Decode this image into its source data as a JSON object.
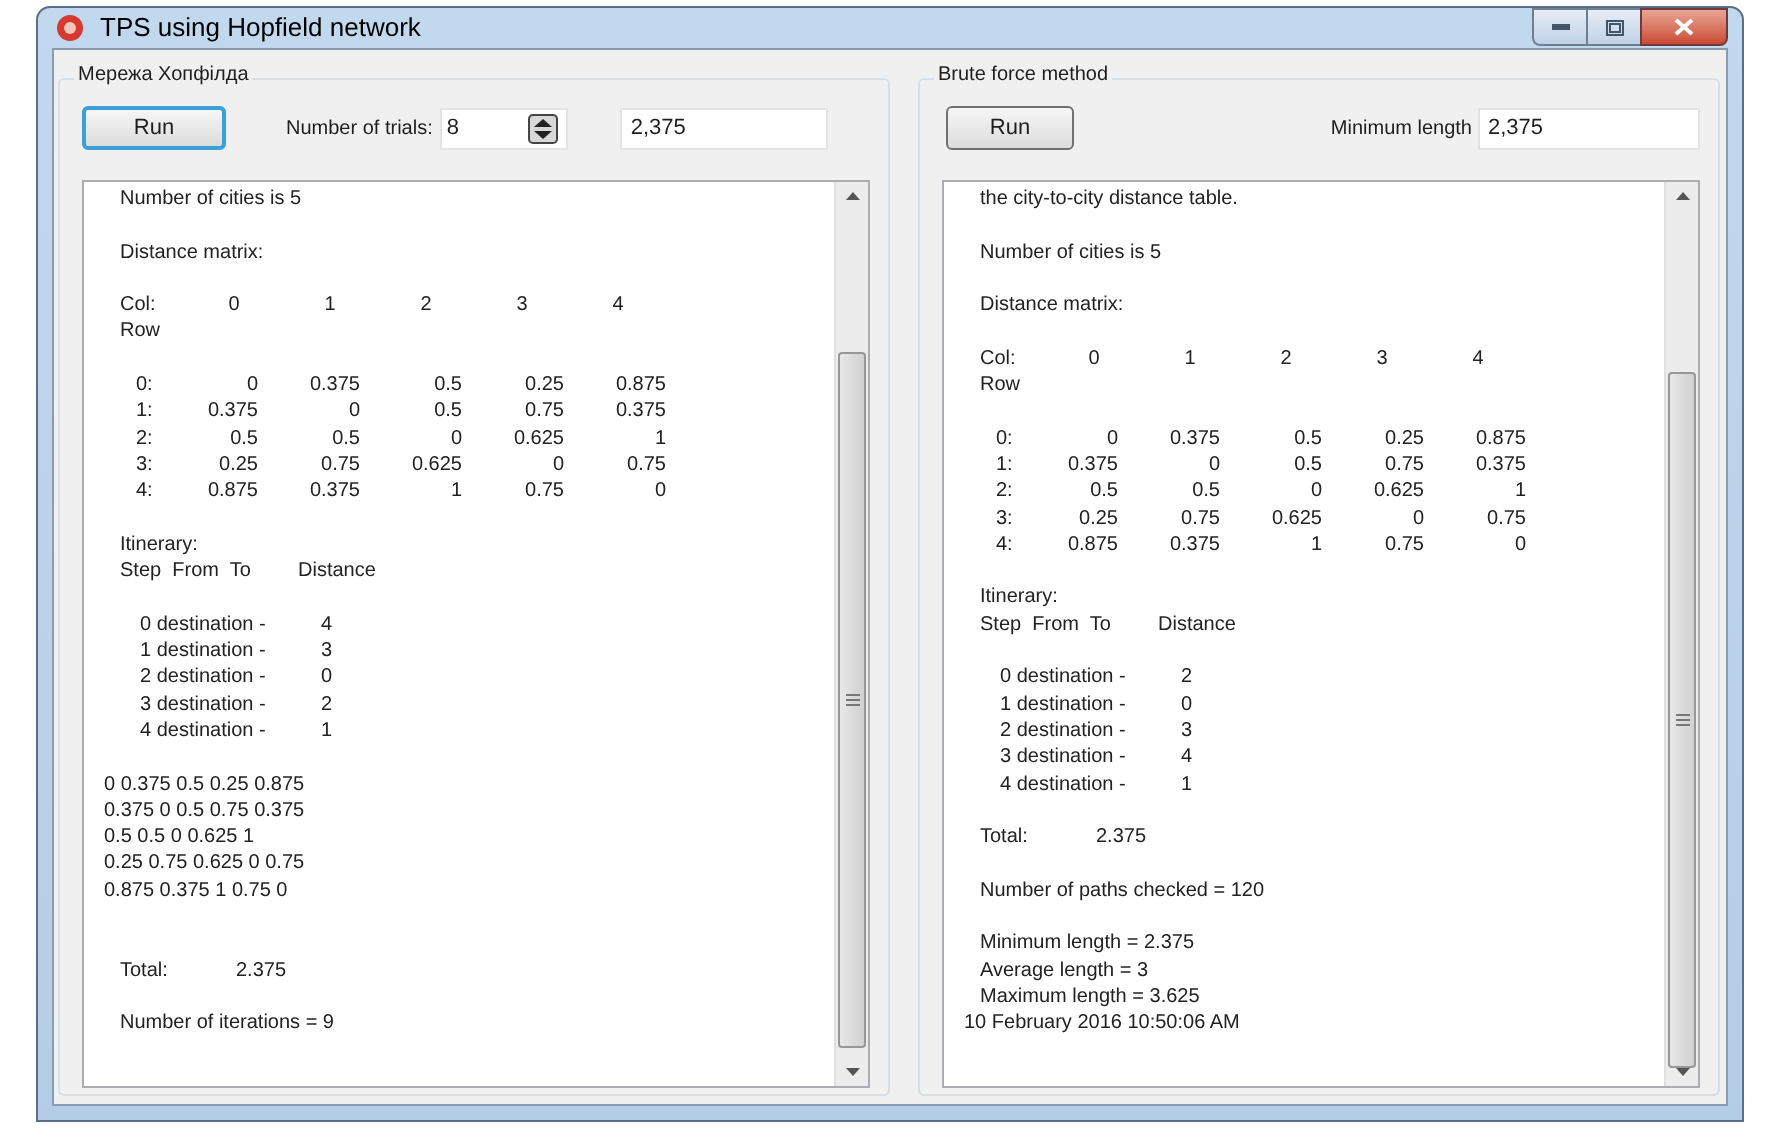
{
  "window": {
    "title": "TPS using Hopfield network"
  },
  "hopfield": {
    "title": "Мережа Хопфілда",
    "run_button": {
      "label": "Run",
      "focused": true
    },
    "trials_label": "Number of trials:",
    "trials_value": "8",
    "result_value": "2,375",
    "output": [
      {
        "kind": "text",
        "text": "Number of cities is 5"
      },
      {
        "kind": "space"
      },
      {
        "kind": "text",
        "text": "Distance matrix:"
      },
      {
        "kind": "space"
      },
      {
        "kind": "header",
        "cells": [
          "Col:",
          "0",
          "1",
          "2",
          "3",
          "4"
        ]
      },
      {
        "kind": "text",
        "text": "Row"
      },
      {
        "kind": "space"
      },
      {
        "kind": "matrix",
        "cells": [
          "0:",
          "0",
          "0.375",
          "0.5",
          "0.25",
          "0.875"
        ]
      },
      {
        "kind": "matrix",
        "cells": [
          "1:",
          "0.375",
          "0",
          "0.5",
          "0.75",
          "0.375"
        ]
      },
      {
        "kind": "matrix",
        "cells": [
          "2:",
          "0.5",
          "0.5",
          "0",
          "0.625",
          "1"
        ]
      },
      {
        "kind": "matrix",
        "cells": [
          "3:",
          "0.25",
          "0.75",
          "0.625",
          "0",
          "0.75"
        ]
      },
      {
        "kind": "matrix",
        "cells": [
          "4:",
          "0.875",
          "0.375",
          "1",
          "0.75",
          "0"
        ]
      },
      {
        "kind": "space"
      },
      {
        "kind": "text",
        "text": "Itinerary:"
      },
      {
        "kind": "itinerary_head",
        "cells": [
          "Step  From  To",
          "Distance"
        ]
      },
      {
        "kind": "space"
      },
      {
        "kind": "itinerary",
        "cells": [
          "0 destination -",
          "4"
        ]
      },
      {
        "kind": "itinerary",
        "cells": [
          "1 destination -",
          "3"
        ]
      },
      {
        "kind": "itinerary",
        "cells": [
          "2 destination -",
          "0"
        ]
      },
      {
        "kind": "itinerary",
        "cells": [
          "3 destination -",
          "2"
        ]
      },
      {
        "kind": "itinerary",
        "cells": [
          "4 destination -",
          "1"
        ]
      },
      {
        "kind": "space"
      },
      {
        "kind": "plain",
        "text": "0 0.375 0.5 0.25 0.875"
      },
      {
        "kind": "plain",
        "text": "0.375 0 0.5 0.75 0.375"
      },
      {
        "kind": "plain",
        "text": "0.5 0.5 0 0.625 1"
      },
      {
        "kind": "plain",
        "text": "0.25 0.75 0.625 0 0.75"
      },
      {
        "kind": "plain",
        "text": "0.875 0.375 1 0.75 0"
      },
      {
        "kind": "space"
      },
      {
        "kind": "space"
      },
      {
        "kind": "total",
        "cells": [
          "Total:",
          "2.375"
        ]
      },
      {
        "kind": "space"
      },
      {
        "kind": "text",
        "text": "Number of iterations = 9"
      }
    ]
  },
  "brute_force": {
    "title": "Brute force method",
    "run_button": {
      "label": "Run",
      "focused": false
    },
    "min_label": "Minimum length",
    "min_value": "2,375",
    "output": [
      {
        "kind": "text",
        "text": "the city-to-city distance table."
      },
      {
        "kind": "space"
      },
      {
        "kind": "text",
        "text": "Number of cities is 5"
      },
      {
        "kind": "space"
      },
      {
        "kind": "text",
        "text": "Distance matrix:"
      },
      {
        "kind": "space"
      },
      {
        "kind": "header",
        "cells": [
          "Col:",
          "0",
          "1",
          "2",
          "3",
          "4"
        ]
      },
      {
        "kind": "text",
        "text": "Row"
      },
      {
        "kind": "space"
      },
      {
        "kind": "matrix",
        "cells": [
          "0:",
          "0",
          "0.375",
          "0.5",
          "0.25",
          "0.875"
        ]
      },
      {
        "kind": "matrix",
        "cells": [
          "1:",
          "0.375",
          "0",
          "0.5",
          "0.75",
          "0.375"
        ]
      },
      {
        "kind": "matrix",
        "cells": [
          "2:",
          "0.5",
          "0.5",
          "0",
          "0.625",
          "1"
        ]
      },
      {
        "kind": "matrix",
        "cells": [
          "3:",
          "0.25",
          "0.75",
          "0.625",
          "0",
          "0.75"
        ]
      },
      {
        "kind": "matrix",
        "cells": [
          "4:",
          "0.875",
          "0.375",
          "1",
          "0.75",
          "0"
        ]
      },
      {
        "kind": "space"
      },
      {
        "kind": "text",
        "text": "Itinerary:"
      },
      {
        "kind": "itinerary_head",
        "cells": [
          "Step  From  To",
          "Distance"
        ]
      },
      {
        "kind": "space"
      },
      {
        "kind": "itinerary",
        "cells": [
          "0 destination -",
          "2"
        ]
      },
      {
        "kind": "itinerary",
        "cells": [
          "1 destination -",
          "0"
        ]
      },
      {
        "kind": "itinerary",
        "cells": [
          "2 destination -",
          "3"
        ]
      },
      {
        "kind": "itinerary",
        "cells": [
          "3 destination -",
          "4"
        ]
      },
      {
        "kind": "itinerary",
        "cells": [
          "4 destination -",
          "1"
        ]
      },
      {
        "kind": "space"
      },
      {
        "kind": "total",
        "cells": [
          "Total:",
          "2.375"
        ]
      },
      {
        "kind": "space"
      },
      {
        "kind": "text",
        "text": "Number of paths checked = 120"
      },
      {
        "kind": "space"
      },
      {
        "kind": "text",
        "text": "Minimum length = 2.375"
      },
      {
        "kind": "text",
        "text": "Average length = 3"
      },
      {
        "kind": "text",
        "text": "Maximum length = 3.625"
      },
      {
        "kind": "plain",
        "text": "10 February 2016 10:50:06 AM"
      }
    ]
  }
}
